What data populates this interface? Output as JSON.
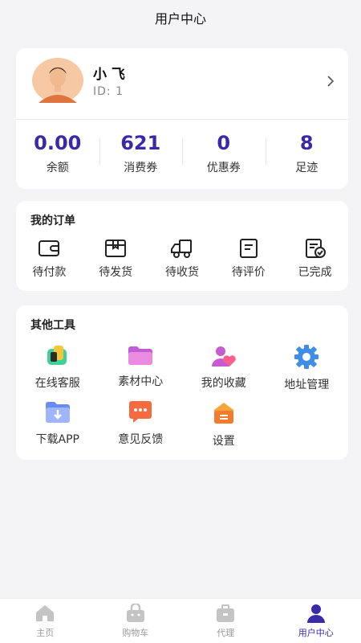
{
  "header": {
    "title": "用户中心"
  },
  "profile": {
    "name": "小  飞",
    "id_text": "ID: 1"
  },
  "stats": [
    {
      "value": "0.00",
      "label": "余额"
    },
    {
      "value": "621",
      "label": "消费券"
    },
    {
      "value": "0",
      "label": "优惠券"
    },
    {
      "value": "8",
      "label": "足迹"
    }
  ],
  "orders": {
    "title": "我的订单",
    "items": [
      {
        "label": "待付款",
        "icon": "wallet-icon"
      },
      {
        "label": "待发货",
        "icon": "box-icon"
      },
      {
        "label": "待收货",
        "icon": "truck-icon"
      },
      {
        "label": "待评价",
        "icon": "review-icon"
      },
      {
        "label": "已完成",
        "icon": "done-icon"
      }
    ]
  },
  "tools": {
    "title": "其他工具",
    "items": [
      {
        "label": "在线客服",
        "icon": "customer-service-icon"
      },
      {
        "label": "素材中心",
        "icon": "folder-icon"
      },
      {
        "label": "我的收藏",
        "icon": "favorites-icon"
      },
      {
        "label": "地址管理",
        "icon": "gear-icon"
      },
      {
        "label": "下载APP",
        "icon": "download-icon"
      },
      {
        "label": "意见反馈",
        "icon": "feedback-icon"
      },
      {
        "label": "设置",
        "icon": "settings-icon"
      }
    ]
  },
  "tabbar": {
    "items": [
      {
        "label": "主页",
        "icon": "home-icon"
      },
      {
        "label": "购物车",
        "icon": "cart-icon"
      },
      {
        "label": "代理",
        "icon": "agent-icon"
      },
      {
        "label": "用户中心",
        "icon": "user-icon"
      }
    ],
    "active_index": 3
  },
  "colors": {
    "accent": "#3b2aa8",
    "background": "#f4f4f6"
  }
}
